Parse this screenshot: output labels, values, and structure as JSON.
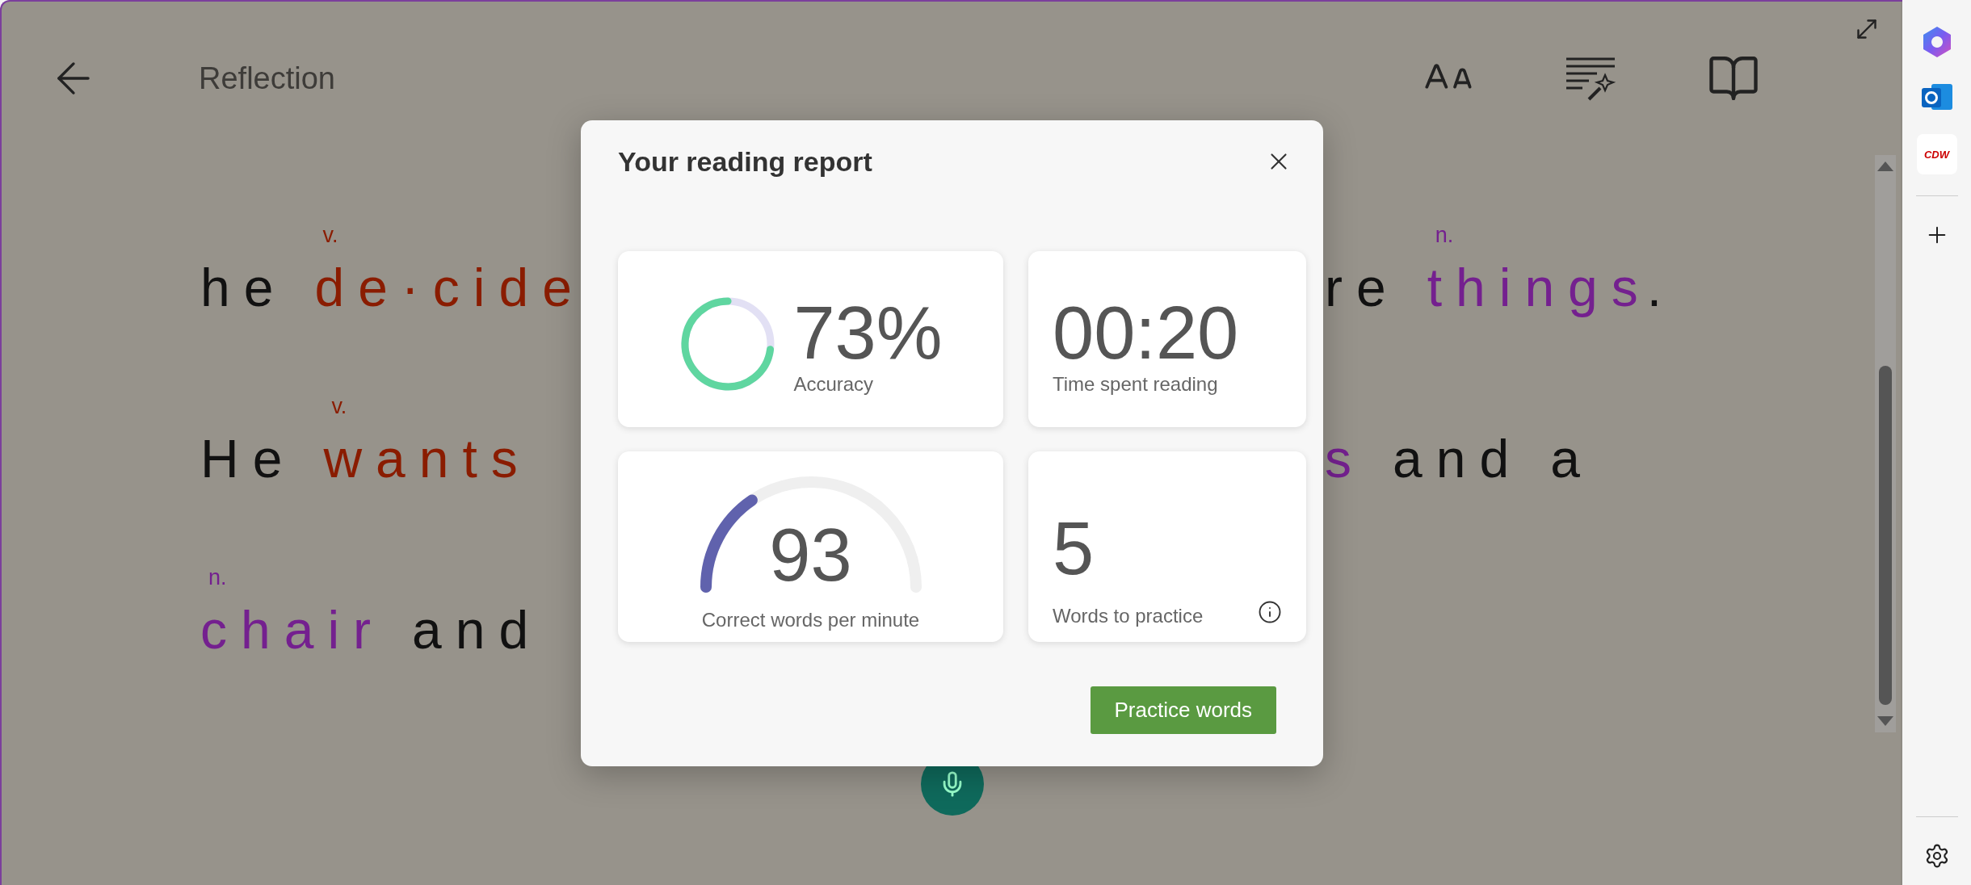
{
  "header": {
    "title": "Reflection"
  },
  "reading_lines": [
    {
      "left": [
        {
          "text": "he",
          "kind": "plain"
        },
        {
          "text": "de·cide",
          "kind": "verb",
          "tag": "v."
        }
      ],
      "right": [
        {
          "text": "re",
          "kind": "plain"
        },
        {
          "text": "things",
          "kind": "noun",
          "tag": "n."
        },
        {
          "text": ".",
          "kind": "punct"
        }
      ]
    },
    {
      "left": [
        {
          "text": "He",
          "kind": "plain"
        },
        {
          "text": "wants",
          "kind": "verb",
          "tag": "v."
        }
      ],
      "right": [
        {
          "text": "s",
          "kind": "noun"
        },
        {
          "text": "and",
          "kind": "plain"
        },
        {
          "text": "a",
          "kind": "plain"
        }
      ]
    },
    {
      "left": [
        {
          "text": "chair",
          "kind": "noun",
          "tag": "n."
        },
        {
          "text": "and",
          "kind": "plain"
        }
      ]
    }
  ],
  "report": {
    "title": "Your reading report",
    "cards": [
      {
        "kind": "ring",
        "value": "73%",
        "label": "Accuracy",
        "level": 0.73
      },
      {
        "kind": "plain",
        "value": "00:20",
        "label": "Time spent reading"
      },
      {
        "kind": "gauge",
        "value": "93",
        "label": "Correct words per minute",
        "level": 0.31
      },
      {
        "kind": "info",
        "value": "5",
        "label": "Words to practice"
      }
    ],
    "button": "Practice words"
  },
  "sidebar": {
    "cdw_logo_text": "CDW"
  }
}
